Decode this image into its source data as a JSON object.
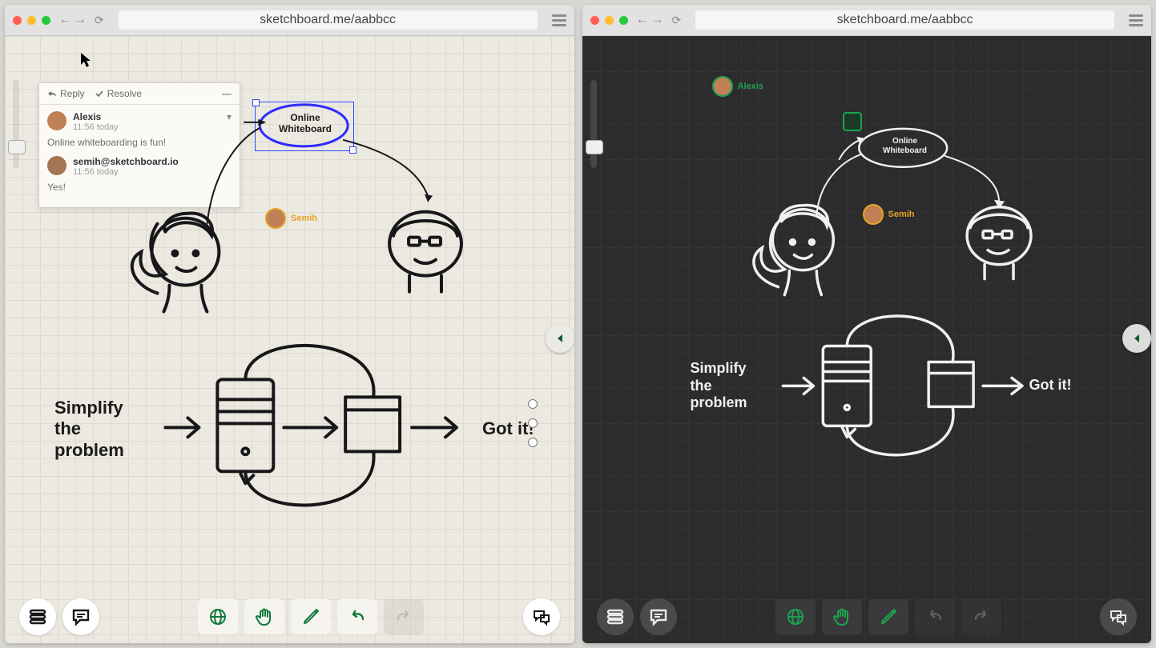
{
  "url": "sketchboard.me/aabbcc",
  "comment_panel": {
    "reply_label": "Reply",
    "resolve_label": "Resolve",
    "items": [
      {
        "author": "Alexis",
        "timestamp": "11:56 today",
        "message": "Online whiteboarding is fun!"
      },
      {
        "author": "semih@sketchboard.io",
        "timestamp": "11:56 today",
        "message": "Yes!"
      }
    ]
  },
  "presence": {
    "light": {
      "name": "Semih",
      "color": "#e6a324"
    },
    "dark_top": {
      "name": "Alexis",
      "color": "#1ba34d"
    },
    "dark_mid": {
      "name": "Semih",
      "color": "#e6a324"
    }
  },
  "nodes": {
    "oval_line1": "Online",
    "oval_line2": "Whiteboard",
    "simplify": "Simplify\nthe\nproblem",
    "gotit": "Got it!"
  },
  "toolbar": {
    "list": "list-view",
    "comments": "comments",
    "globe": "share-globe",
    "hand": "pan-hand",
    "pencil": "draw-pencil",
    "undo": "undo",
    "redo": "redo",
    "chat": "chat"
  }
}
